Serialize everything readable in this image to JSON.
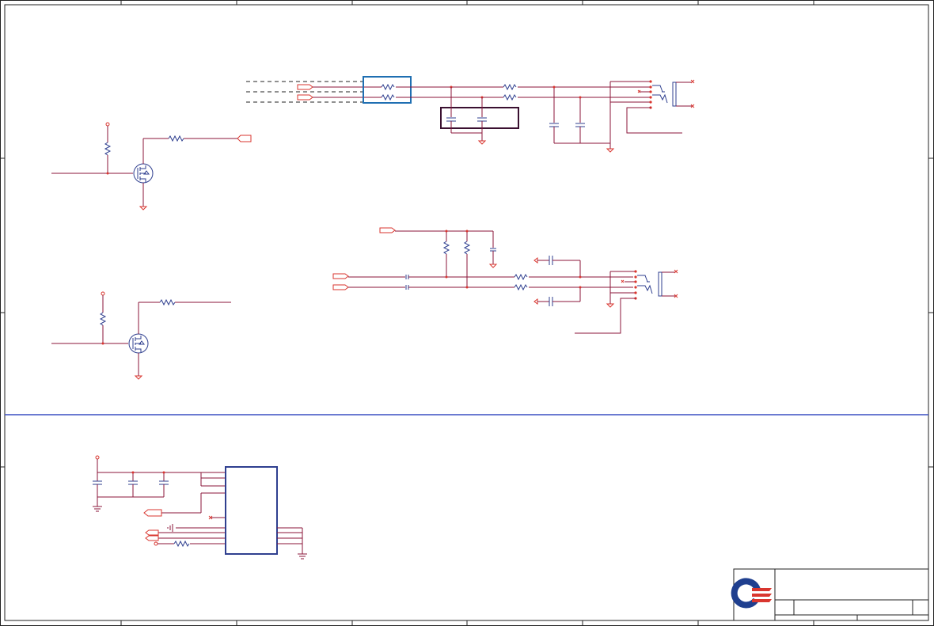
{
  "page": {
    "colors": {
      "wire": "#8b1538",
      "pin": "#d9362f",
      "component": "#2f3f8f",
      "frame": "#222222",
      "divider": "#3a4ec2",
      "highlight_box": "#1f6fb2",
      "logo_blue": "#1f3f8f",
      "logo_red": "#d9362f"
    }
  },
  "schematic": {
    "sections": [
      {
        "name": "top",
        "components": [
          "fet-circuit",
          "fet-circuit",
          "audio-jack",
          "audio-jack",
          "filter-box"
        ]
      },
      {
        "name": "bottom",
        "components": [
          "ic-block",
          "decoupling-caps"
        ]
      }
    ]
  },
  "title_block": {
    "logo": "company-logo"
  }
}
